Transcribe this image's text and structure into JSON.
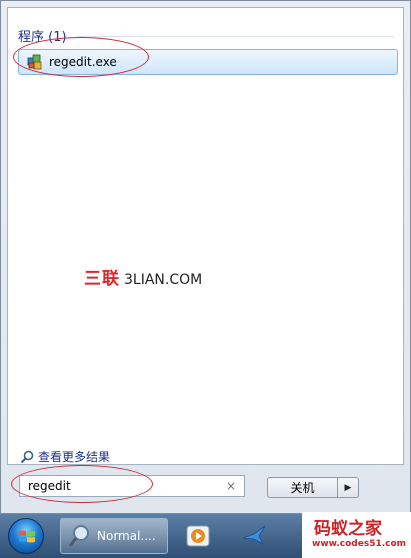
{
  "results": {
    "section_header": "程序 (1)",
    "items": [
      {
        "label": "regedit.exe",
        "icon": "registry-editor-icon"
      }
    ]
  },
  "watermark": {
    "brand_cn": "三联",
    "brand_en": "3LIAN.COM"
  },
  "more_results_label": "查看更多结果",
  "search": {
    "value": "regedit",
    "clear_symbol": "×"
  },
  "shutdown": {
    "label": "关机",
    "arrow": "▶"
  },
  "taskbar": {
    "items": [
      {
        "label": "Normal....",
        "icon": "search-magnifier-icon"
      }
    ]
  },
  "site_mark": {
    "title": "码蚁之家",
    "url": "www.codes51.com"
  },
  "colors": {
    "annotation": "#d02a3a",
    "link_blue": "#1e3287",
    "watermark_red": "#e0262c"
  }
}
